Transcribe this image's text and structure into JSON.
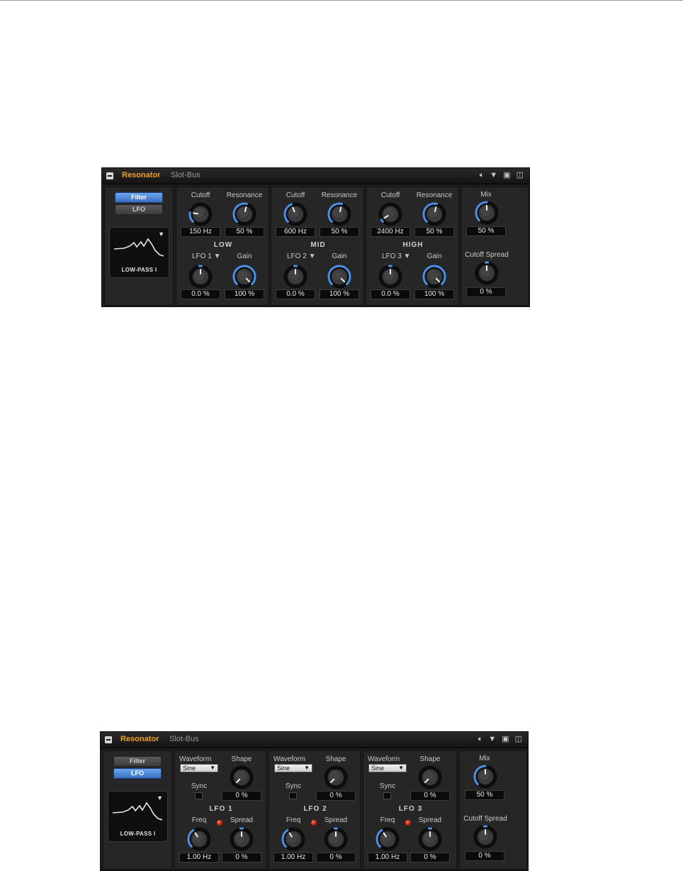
{
  "top": {
    "title": "Resonator",
    "bus": "Slot-Bus",
    "mode_filter": "Filter",
    "mode_lfo": "LFO",
    "active_mode": "Filter",
    "filter_type": "LOW-PASS I",
    "bands": [
      {
        "name": "LOW",
        "cutoff_label": "Cutoff",
        "cutoff": "150 Hz",
        "resonance_label": "Resonance",
        "resonance": "50 %",
        "lfo_label": "LFO 1",
        "lfo_value": "0.0 %",
        "gain_label": "Gain",
        "gain": "100 %"
      },
      {
        "name": "MID",
        "cutoff_label": "Cutoff",
        "cutoff": "600 Hz",
        "resonance_label": "Resonance",
        "resonance": "50 %",
        "lfo_label": "LFO 2",
        "lfo_value": "0.0 %",
        "gain_label": "Gain",
        "gain": "100 %"
      },
      {
        "name": "HIGH",
        "cutoff_label": "Cutoff",
        "cutoff": "2400 Hz",
        "resonance_label": "Resonance",
        "resonance": "50 %",
        "lfo_label": "LFO 3",
        "lfo_value": "0.0 %",
        "gain_label": "Gain",
        "gain": "100 %"
      }
    ],
    "mix_label": "Mix",
    "mix": "50 %",
    "spread_label": "Cutoff Spread",
    "spread": "0 %"
  },
  "bottom": {
    "title": "Resonator",
    "bus": "Slot-Bus",
    "mode_filter": "Filter",
    "mode_lfo": "LFO",
    "active_mode": "LFO",
    "filter_type": "LOW-PASS I",
    "lfos": [
      {
        "name": "LFO 1",
        "waveform_label": "Waveform",
        "waveform": "Sine",
        "shape_label": "Shape",
        "shape": "0 %",
        "sync_label": "Sync",
        "freq_label": "Freq",
        "freq": "1.00 Hz",
        "spread_label": "Spread",
        "spread": "0 %"
      },
      {
        "name": "LFO 2",
        "waveform_label": "Waveform",
        "waveform": "Sine",
        "shape_label": "Shape",
        "shape": "0 %",
        "sync_label": "Sync",
        "freq_label": "Freq",
        "freq": "1.00 Hz",
        "spread_label": "Spread",
        "spread": "0 %"
      },
      {
        "name": "LFO 3",
        "waveform_label": "Waveform",
        "waveform": "Sine",
        "shape_label": "Shape",
        "shape": "0 %",
        "sync_label": "Sync",
        "freq_label": "Freq",
        "freq": "1.00 Hz",
        "spread_label": "Spread",
        "spread": "0 %"
      }
    ],
    "mix_label": "Mix",
    "mix": "50 %",
    "spread_label": "Cutoff Spread",
    "spread": "0 %"
  },
  "colors": {
    "accent": "#f0a020",
    "knob_arc": "#4a90e8",
    "active_button": "#4a86d8",
    "led": "#e02010"
  }
}
